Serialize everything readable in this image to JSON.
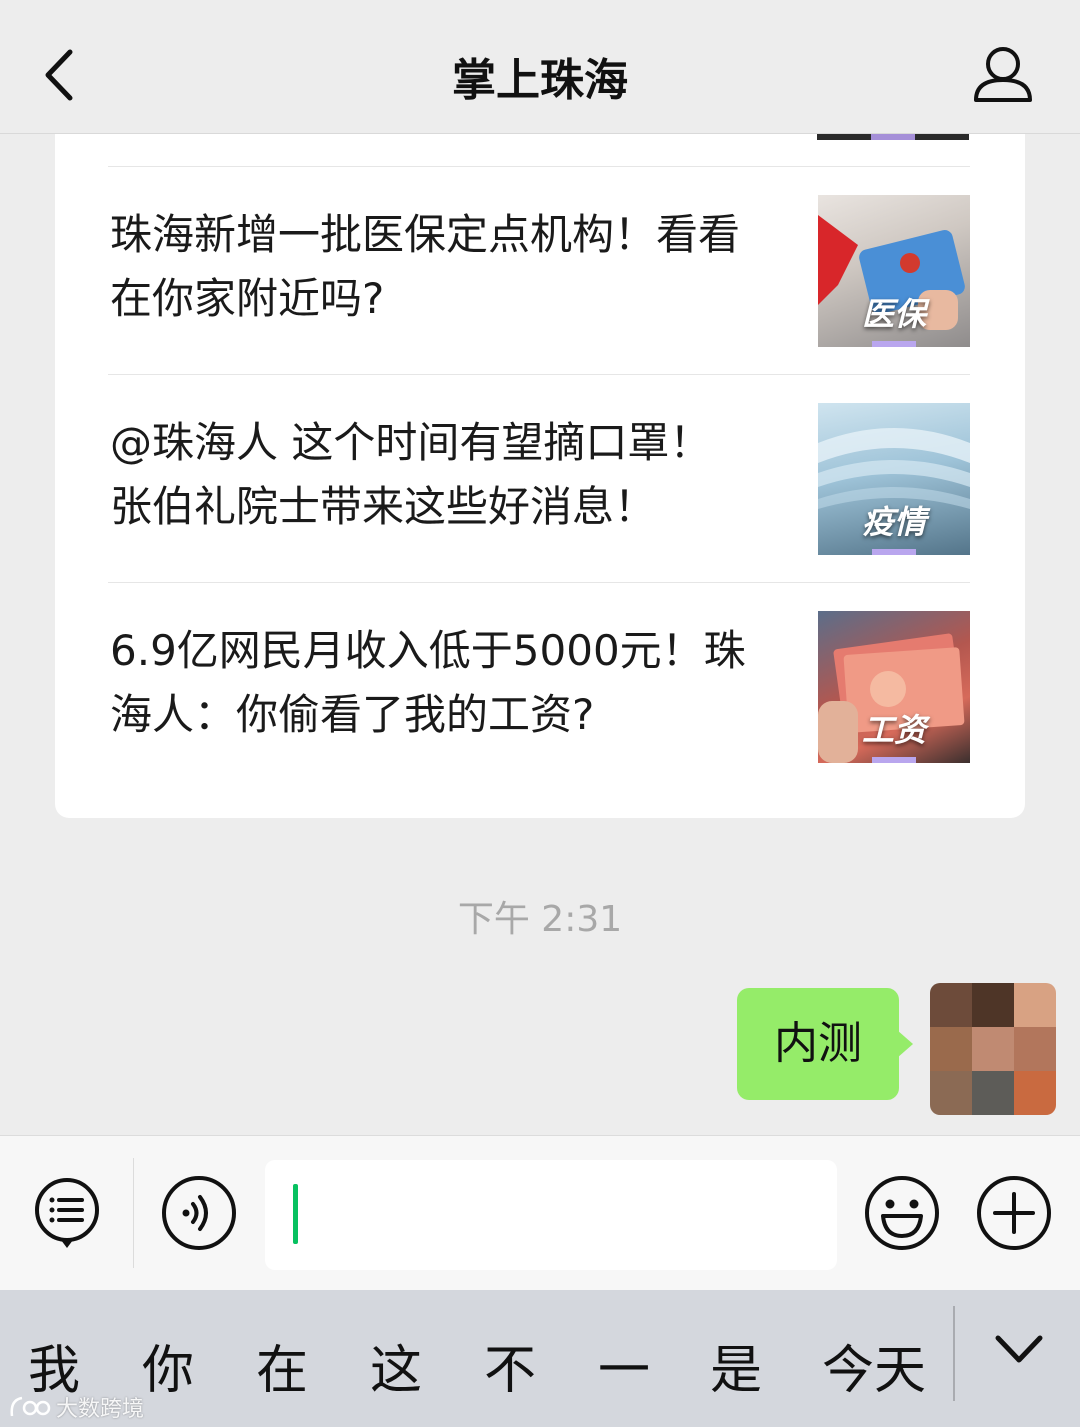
{
  "header": {
    "title": "掌上珠海",
    "back_icon": "chevron-left-icon",
    "profile_icon": "person-icon"
  },
  "articles": [
    {
      "title": "珠海新增一批医保定点机构！看看在你家附近吗?",
      "thumb_tag": "医保"
    },
    {
      "title": "@珠海人 这个时间有望摘口罩！张伯礼院士带来这些好消息！",
      "thumb_tag": "疫情"
    },
    {
      "title": "6.9亿网民月收入低于5000元！珠海人：你偷看了我的工资?",
      "thumb_tag": "工资"
    }
  ],
  "timestamp": "下午 2:31",
  "message": {
    "text": "内测",
    "bubble_color": "#95ec69"
  },
  "input_bar": {
    "menu_icon": "list-menu-icon",
    "voice_icon": "voice-icon",
    "emoji_icon": "emoji-icon",
    "plus_icon": "plus-icon",
    "caret_color": "#07c160"
  },
  "keyboard": {
    "candidates": [
      "我",
      "你",
      "在",
      "这",
      "不",
      "一",
      "是",
      "今天"
    ],
    "collapse_icon": "chevron-down-icon"
  },
  "watermark": {
    "text": "大数跨境"
  }
}
